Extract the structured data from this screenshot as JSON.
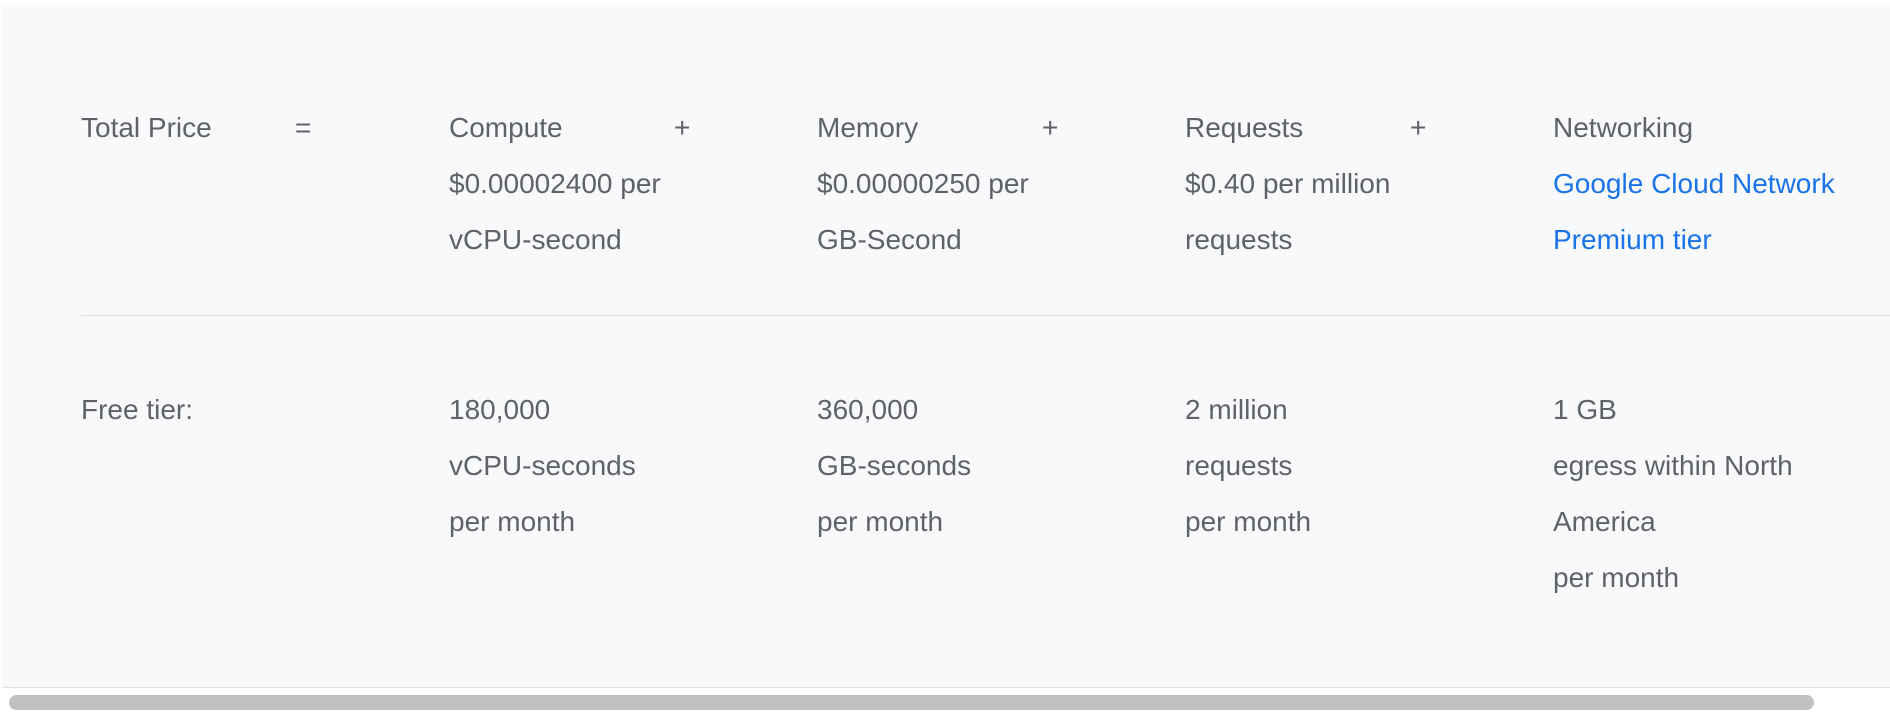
{
  "pricing": {
    "total_label": "Total Price",
    "equals": "=",
    "plus": "+",
    "columns": [
      {
        "header": "Compute",
        "price_lines": [
          "$0.00002400 per",
          "vCPU-second"
        ]
      },
      {
        "header": "Memory",
        "price_lines": [
          "$0.00000250 per",
          "GB-Second"
        ]
      },
      {
        "header": "Requests",
        "price_lines": [
          "$0.40 per million",
          "requests"
        ]
      },
      {
        "header": "Networking",
        "link_lines": [
          "Google Cloud Network",
          "Premium tier"
        ]
      }
    ]
  },
  "free_tier": {
    "label": "Free tier:",
    "columns": [
      {
        "lines": [
          "180,000",
          "vCPU-seconds",
          "per month"
        ]
      },
      {
        "lines": [
          "360,000",
          "GB-seconds",
          "per month"
        ]
      },
      {
        "lines": [
          "2 million",
          "requests",
          "per month"
        ]
      },
      {
        "lines": [
          "1 GB",
          "egress within North",
          "America",
          "per month"
        ]
      }
    ]
  },
  "colors": {
    "text": "#5f6368",
    "link": "#1a73e8",
    "panel_background": "#f8f9fa",
    "divider": "#dadce0",
    "scrollbar_thumb": "#c1c1c1"
  }
}
